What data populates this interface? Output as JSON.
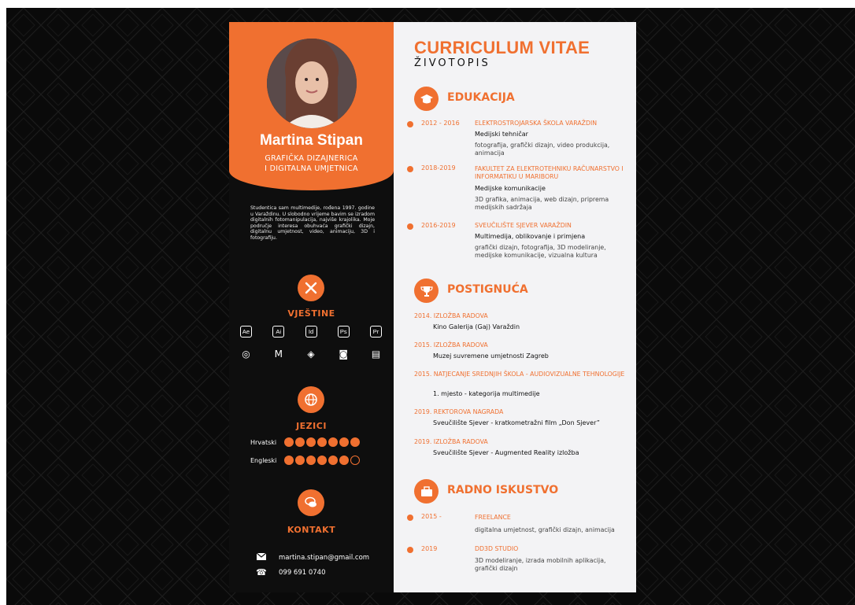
{
  "name": "Martina Stipan",
  "job_line1": "GRAFIČKA DIZAJNERICA",
  "job_line2": "I DIGITALNA UMJETNICA",
  "about": "Studentica sam multimedije, rođena 1997. godine u Varaždinu. U slobodno vrijeme bavim se izradom digitalnih fotomanipulacija, najviše krajolika. Moje područje interesa obuhvaća grafički dizajn, digitalnu umjetnost, video, animaciju, 3D i fotografiju.",
  "skills": {
    "title": "VJEŠTINE",
    "software": [
      "Ae",
      "Ai",
      "Id",
      "Ps",
      "Pr"
    ],
    "tools": [
      {
        "icon": "blender-icon",
        "glyph": "◎"
      },
      {
        "icon": "maya-icon",
        "glyph": "M"
      },
      {
        "icon": "unity-icon",
        "glyph": "◈"
      },
      {
        "icon": "camera-icon",
        "glyph": "◙"
      },
      {
        "icon": "clapperboard-icon",
        "glyph": "▤"
      }
    ]
  },
  "languages": {
    "title": "JEZICI",
    "items": [
      {
        "name": "Hrvatski",
        "level": 7,
        "max": 7
      },
      {
        "name": "Engleski",
        "level": 6,
        "max": 7
      }
    ]
  },
  "contact": {
    "title": "KONTAKT",
    "email": "martina.stipan@gmail.com",
    "phone": "099 691 0740"
  },
  "header": {
    "title": "CURRICULUM VITAE",
    "subtitle": "ŽIVOTOPIS"
  },
  "education": {
    "title": "EDUKACIJA",
    "items": [
      {
        "years": "2012 - 2016",
        "school": "ELEKTROSTROJARSKA ŠKOLA VARAŽDIN",
        "program": "Medijski tehničar",
        "desc": "fotografija, grafički dizajn, video produkcija, animacija"
      },
      {
        "years": "2018-2019",
        "school": "FAKULTET ZA ELEKTROTEHNIKU RAČUNARSTVO I INFORMATIKU U MARIBORU",
        "program": "Medijske komunikacije",
        "desc": "3D grafika, animacija, web dizajn, priprema medijskih sadržaja"
      },
      {
        "years": "2016-2019",
        "school": "SVEUČILIŠTE SJEVER VARAŽDIN",
        "program": "Multimedija, oblikovanje i primjena",
        "desc": "grafički dizajn, fotografija, 3D modeliranje, medijske komunikacije, vizualna kultura"
      }
    ]
  },
  "achievements": {
    "title": "POSTIGNUĆA",
    "items": [
      {
        "title": "2014. IZLOŽBA RADOVA",
        "desc": "Kino Galerija (Gaj) Varaždin"
      },
      {
        "title": "2015. IZLOŽBA RADOVA",
        "desc": "Muzej suvremene umjetnosti Zagreb"
      },
      {
        "title": "2015. NATJECANJE SREDNJIH ŠKOLA - AUDIOVIZUALNE TEHNOLOGIJE",
        "desc": "1. mjesto - kategorija multimedije"
      },
      {
        "title": "2019. REKTOROVA NAGRADA",
        "desc": "Sveučilište Sjever - kratkometražni film „Don Sjever”"
      },
      {
        "title": "2019. IZLOŽBA RADOVA",
        "desc": "Sveučilište Sjever - Augmented Reality izložba"
      }
    ]
  },
  "work": {
    "title": "RADNO ISKUSTVO",
    "items": [
      {
        "years": "2015 -",
        "company": "FREELANCE",
        "desc": "digitalna umjetnost, grafički dizajn, animacija"
      },
      {
        "years": "2019",
        "company": "DD3D STUDIO",
        "desc": "3D modeliranje, izrada mobilnih aplikacija, grafički dizajn"
      }
    ]
  },
  "colors": {
    "accent": "#f07030",
    "dark": "#0e0e0e",
    "paper": "#f3f3f5"
  }
}
